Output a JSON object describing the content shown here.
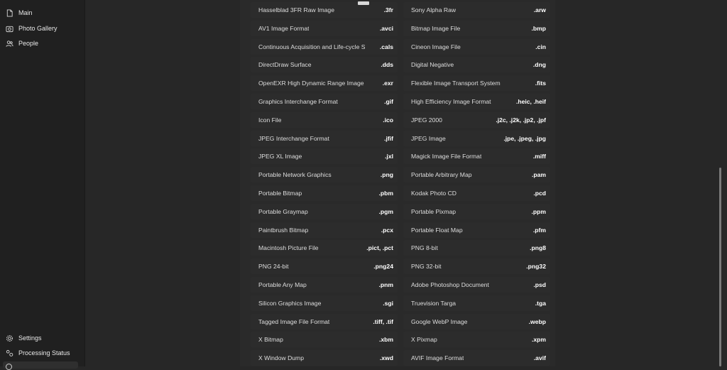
{
  "sidebar": {
    "items": [
      {
        "label": "Main",
        "icon": "document-icon"
      },
      {
        "label": "Photo Gallery",
        "icon": "camera-icon"
      },
      {
        "label": "People",
        "icon": "people-icon"
      }
    ],
    "bottom_items": [
      {
        "label": "Settings",
        "icon": "gear-icon"
      },
      {
        "label": "Processing Status",
        "icon": "processing-icon"
      }
    ]
  },
  "formats": [
    {
      "name": "Hasselblad 3FR Raw Image",
      "ext": ".3fr"
    },
    {
      "name": "Sony Alpha Raw",
      "ext": ".arw"
    },
    {
      "name": "AV1 Image Format",
      "ext": ".avci"
    },
    {
      "name": "Bitmap Image File",
      "ext": ".bmp"
    },
    {
      "name": "Continuous Acquisition and Life-cycle S...",
      "ext": ".cals"
    },
    {
      "name": "Cineon Image File",
      "ext": ".cin"
    },
    {
      "name": "DirectDraw Surface",
      "ext": ".dds"
    },
    {
      "name": "Digital Negative",
      "ext": ".dng"
    },
    {
      "name": "OpenEXR High Dynamic Range Image File",
      "ext": ".exr"
    },
    {
      "name": "Flexible Image Transport System",
      "ext": ".fits"
    },
    {
      "name": "Graphics Interchange Format",
      "ext": ".gif"
    },
    {
      "name": "High Efficiency Image Format",
      "ext": ".heic, .heif"
    },
    {
      "name": "Icon File",
      "ext": ".ico"
    },
    {
      "name": "JPEG 2000",
      "ext": ".j2c, .j2k, .jp2, .jpf"
    },
    {
      "name": "JPEG Interchange Format",
      "ext": ".jfif"
    },
    {
      "name": "JPEG Image",
      "ext": ".jpe, .jpeg, .jpg"
    },
    {
      "name": "JPEG XL Image",
      "ext": ".jxl"
    },
    {
      "name": "Magick Image File Format",
      "ext": ".miff"
    },
    {
      "name": "Portable Network Graphics",
      "ext": ".png"
    },
    {
      "name": "Portable Arbitrary Map",
      "ext": ".pam"
    },
    {
      "name": "Portable Bitmap",
      "ext": ".pbm"
    },
    {
      "name": "Kodak Photo CD",
      "ext": ".pcd"
    },
    {
      "name": "Portable Graymap",
      "ext": ".pgm"
    },
    {
      "name": "Portable Pixmap",
      "ext": ".ppm"
    },
    {
      "name": "Paintbrush Bitmap",
      "ext": ".pcx"
    },
    {
      "name": "Portable Float Map",
      "ext": ".pfm"
    },
    {
      "name": "Macintosh Picture File",
      "ext": ".pict, .pct"
    },
    {
      "name": "PNG 8-bit",
      "ext": ".png8"
    },
    {
      "name": "PNG 24-bit",
      "ext": ".png24"
    },
    {
      "name": "PNG 32-bit",
      "ext": ".png32"
    },
    {
      "name": "Portable Any Map",
      "ext": ".pnm"
    },
    {
      "name": "Adobe Photoshop Document",
      "ext": ".psd"
    },
    {
      "name": "Silicon Graphics Image",
      "ext": ".sgi"
    },
    {
      "name": "Truevision Targa",
      "ext": ".tga"
    },
    {
      "name": "Tagged Image File Format",
      "ext": ".tiff, .tif"
    },
    {
      "name": "Google WebP Image",
      "ext": ".webp"
    },
    {
      "name": "X Bitmap",
      "ext": ".xbm"
    },
    {
      "name": "X Pixmap",
      "ext": ".xpm"
    },
    {
      "name": "X Window Dump",
      "ext": ".xwd"
    },
    {
      "name": "AVIF Image Format",
      "ext": ".avif"
    }
  ]
}
